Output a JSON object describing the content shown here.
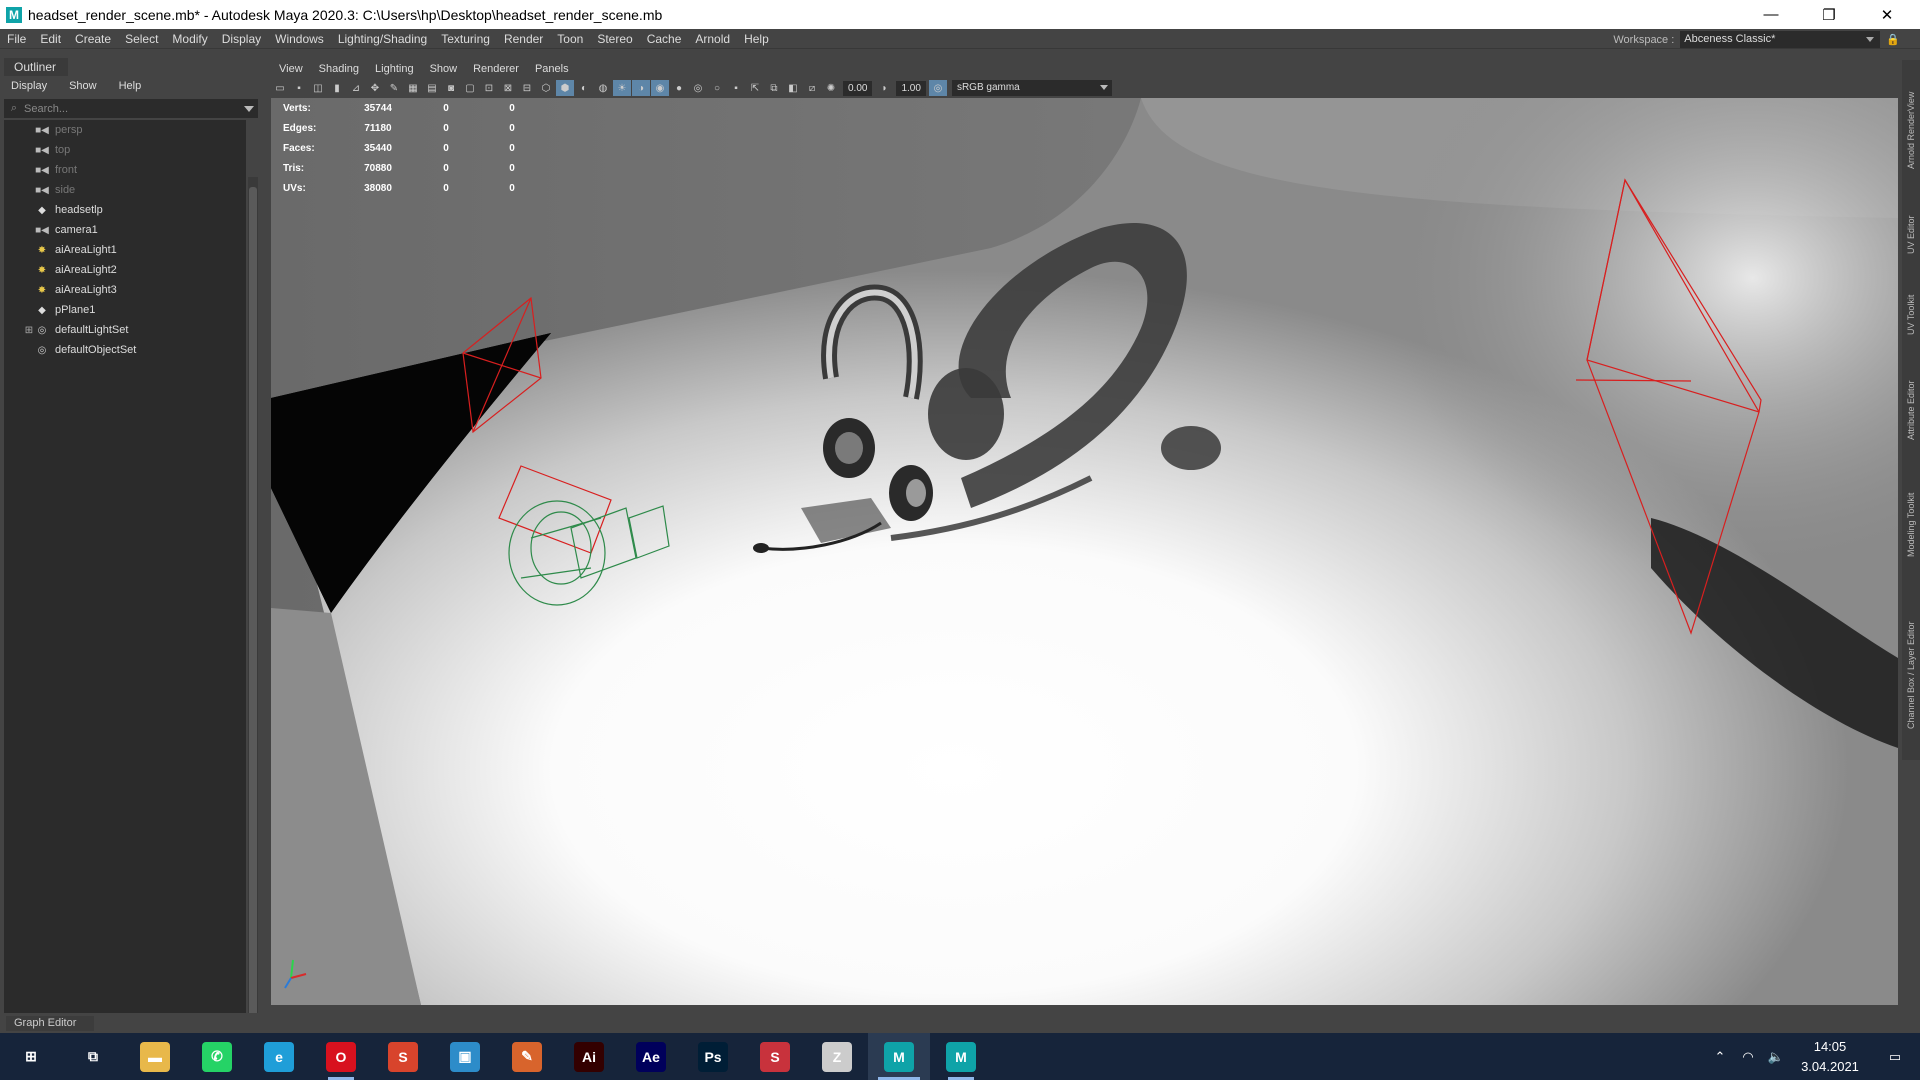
{
  "window": {
    "title": "headset_render_scene.mb* - Autodesk Maya 2020.3: C:\\Users\\hp\\Desktop\\headset_render_scene.mb",
    "logo_letter": "M",
    "minimize_glyph": "—",
    "maximize_glyph": "❐",
    "close_glyph": "✕"
  },
  "menubar": [
    "File",
    "Edit",
    "Create",
    "Select",
    "Modify",
    "Display",
    "Windows",
    "Lighting/Shading",
    "Texturing",
    "Render",
    "Toon",
    "Stereo",
    "Cache",
    "Arnold",
    "Help"
  ],
  "workspace": {
    "label": "Workspace :",
    "value": "Abceness Classic*"
  },
  "outliner": {
    "tab": "Outliner",
    "menu": [
      "Display",
      "Show",
      "Help"
    ],
    "search_placeholder": "Search...",
    "items": [
      {
        "label": "persp",
        "icon": "camera-icon",
        "dim": true
      },
      {
        "label": "top",
        "icon": "camera-icon",
        "dim": true
      },
      {
        "label": "front",
        "icon": "camera-icon",
        "dim": true
      },
      {
        "label": "side",
        "icon": "camera-icon",
        "dim": true
      },
      {
        "label": "headsetlp",
        "icon": "transform-icon",
        "dim": false
      },
      {
        "label": "camera1",
        "icon": "camera-icon",
        "dim": false
      },
      {
        "label": "aiAreaLight1",
        "icon": "light-icon",
        "dim": false
      },
      {
        "label": "aiAreaLight2",
        "icon": "light-icon",
        "dim": false
      },
      {
        "label": "aiAreaLight3",
        "icon": "light-icon",
        "dim": false
      },
      {
        "label": "pPlane1",
        "icon": "transform-icon",
        "dim": false
      },
      {
        "label": "defaultLightSet",
        "icon": "set-icon",
        "dim": false,
        "expand": "⊞"
      },
      {
        "label": "defaultObjectSet",
        "icon": "set-icon",
        "dim": false
      }
    ]
  },
  "panel_menu": [
    "View",
    "Shading",
    "Lighting",
    "Show",
    "Renderer",
    "Panels"
  ],
  "toolbar": {
    "exposure": "0.00",
    "gamma": "1.00",
    "color_space": "sRGB gamma"
  },
  "stats": {
    "rows": [
      {
        "label": "Verts:",
        "value": "35744",
        "a": "0",
        "b": "0"
      },
      {
        "label": "Edges:",
        "value": "71180",
        "a": "0",
        "b": "0"
      },
      {
        "label": "Faces:",
        "value": "35440",
        "a": "0",
        "b": "0"
      },
      {
        "label": "Tris:",
        "value": "70880",
        "a": "0",
        "b": "0"
      },
      {
        "label": "UVs:",
        "value": "38080",
        "a": "0",
        "b": "0"
      }
    ]
  },
  "right_tabs": [
    "Arnold RenderView",
    "UV Editor",
    "UV Toolkit",
    "Attribute Editor",
    "Modeling Toolkit",
    "Channel Box / Layer Editor"
  ],
  "bottom_panel": "Graph Editor",
  "taskbar": {
    "apps": [
      {
        "name": "start-icon",
        "glyph": "⊞",
        "bg": "transparent"
      },
      {
        "name": "task-view-icon",
        "glyph": "⧉",
        "bg": "transparent"
      },
      {
        "name": "file-explorer-icon",
        "glyph": "▬",
        "bg": "#e8b84a"
      },
      {
        "name": "whatsapp-icon",
        "glyph": "✆",
        "bg": "#25d366"
      },
      {
        "name": "edge-icon",
        "glyph": "e",
        "bg": "#1f9ed8"
      },
      {
        "name": "opera-icon",
        "glyph": "O",
        "bg": "#d8111e"
      },
      {
        "name": "substance-icon",
        "glyph": "S",
        "bg": "#d8442c"
      },
      {
        "name": "app-box-icon",
        "glyph": "▣",
        "bg": "#2d8cc9"
      },
      {
        "name": "pencil-app-icon",
        "glyph": "✎",
        "bg": "#d8642c"
      },
      {
        "name": "illustrator-icon",
        "glyph": "Ai",
        "bg": "#330000"
      },
      {
        "name": "after-effects-icon",
        "glyph": "Ae",
        "bg": "#00005b"
      },
      {
        "name": "photoshop-icon",
        "glyph": "Ps",
        "bg": "#001e36"
      },
      {
        "name": "substance-painter-icon",
        "glyph": "S",
        "bg": "#c8323c"
      },
      {
        "name": "zbrush-icon",
        "glyph": "Z",
        "bg": "#ccc"
      },
      {
        "name": "maya-icon",
        "glyph": "M",
        "bg": "#0fa3a8"
      },
      {
        "name": "maya-2-icon",
        "glyph": "M",
        "bg": "#0fa3a8"
      }
    ],
    "active_index": 14,
    "open_indices": [
      5,
      15
    ]
  },
  "tray": {
    "up_arrow": "⌃",
    "network": "◠",
    "volume": "🔈",
    "time": "14:05",
    "date": "3.04.2021",
    "notification": "▭"
  }
}
